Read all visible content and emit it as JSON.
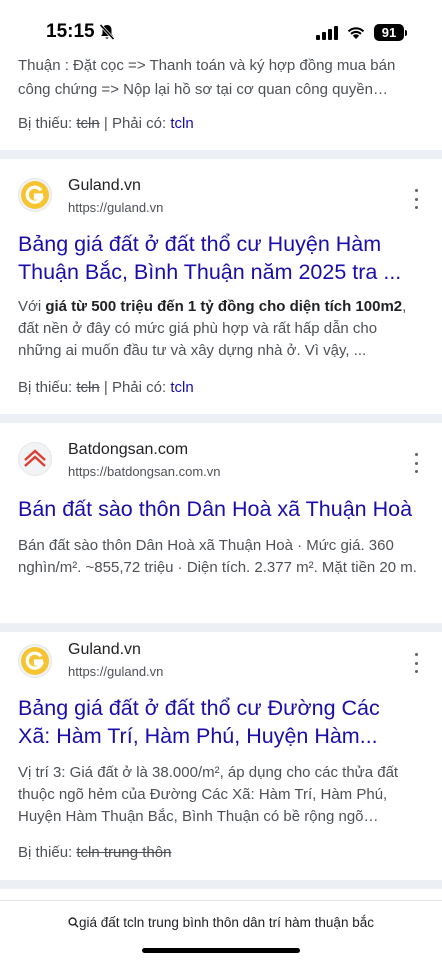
{
  "status_bar": {
    "time": "15:15",
    "battery": "91"
  },
  "result0": {
    "snippet_line1": "Thuận : Đặt cọc => Thanh toán và ký hợp đồng mua bán",
    "snippet_line2": "công chứng => Nộp lại hồ sơ tại cơ quan công quyền…",
    "missing_label": "Bị thiếu: ",
    "missing_term": "tcln",
    "must_have_label": " | Phải có: ",
    "must_have_term": "tcln"
  },
  "result1": {
    "site_name": "Guland.vn",
    "site_url": "https://guland.vn",
    "title_line1": "Bảng giá đất ở đất thổ cư Huyện Hàm",
    "title_line2": "Thuận Bắc, Bình Thuận năm 2025 tra ...",
    "snippet_pre": "Với ",
    "snippet_bold": "giá từ 500 triệu đến 1 tỷ đồng cho diện tích 100m2",
    "snippet_post": ", đất nền ở đây có mức giá phù hợp và rất hấp dẫn cho những ai muốn đầu tư và xây dựng nhà ở. Vì vậy, ...",
    "missing_label": "Bị thiếu: ",
    "missing_term": "tcln",
    "must_have_label": " | Phải có: ",
    "must_have_term": "tcln"
  },
  "result2": {
    "site_name": "Batdongsan.com",
    "site_url": "https://batdongsan.com.vn",
    "title": "Bán đất sào thôn Dân Hoà xã Thuận Hoà",
    "snippet": "Bán đất sào thôn Dân Hoà xã Thuận Hoà · Mức giá. 360 nghìn/m². ~855,72 triệu · Diện tích. 2.377 m². Mặt tiền 20 m."
  },
  "result3": {
    "site_name": "Guland.vn",
    "site_url": "https://guland.vn",
    "title_line1": "Bảng giá đất ở đất thổ cư Đường Các",
    "title_line2": "Xã: Hàm Trí, Hàm Phú, Huyện Hàm...",
    "snippet": "Vị trí 3: Giá đất ở là 38.000/m², áp dụng cho các thửa đất thuộc ngõ hẻm của Đường Các Xã: Hàm Trí, Hàm Phú, Huyện Hàm Thuận Bắc, Bình Thuận có bề rộng ngõ…",
    "missing_label": "Bị thiếu: ",
    "missing_terms": "tcln trung thôn"
  },
  "bottom_bar": {
    "query": "giá đất tcln trung bình thôn dân trí hàm thuận bắc"
  },
  "colors": {
    "link": "#1a0dab",
    "separator": "#eceff3",
    "snippet": "#4d5156"
  }
}
